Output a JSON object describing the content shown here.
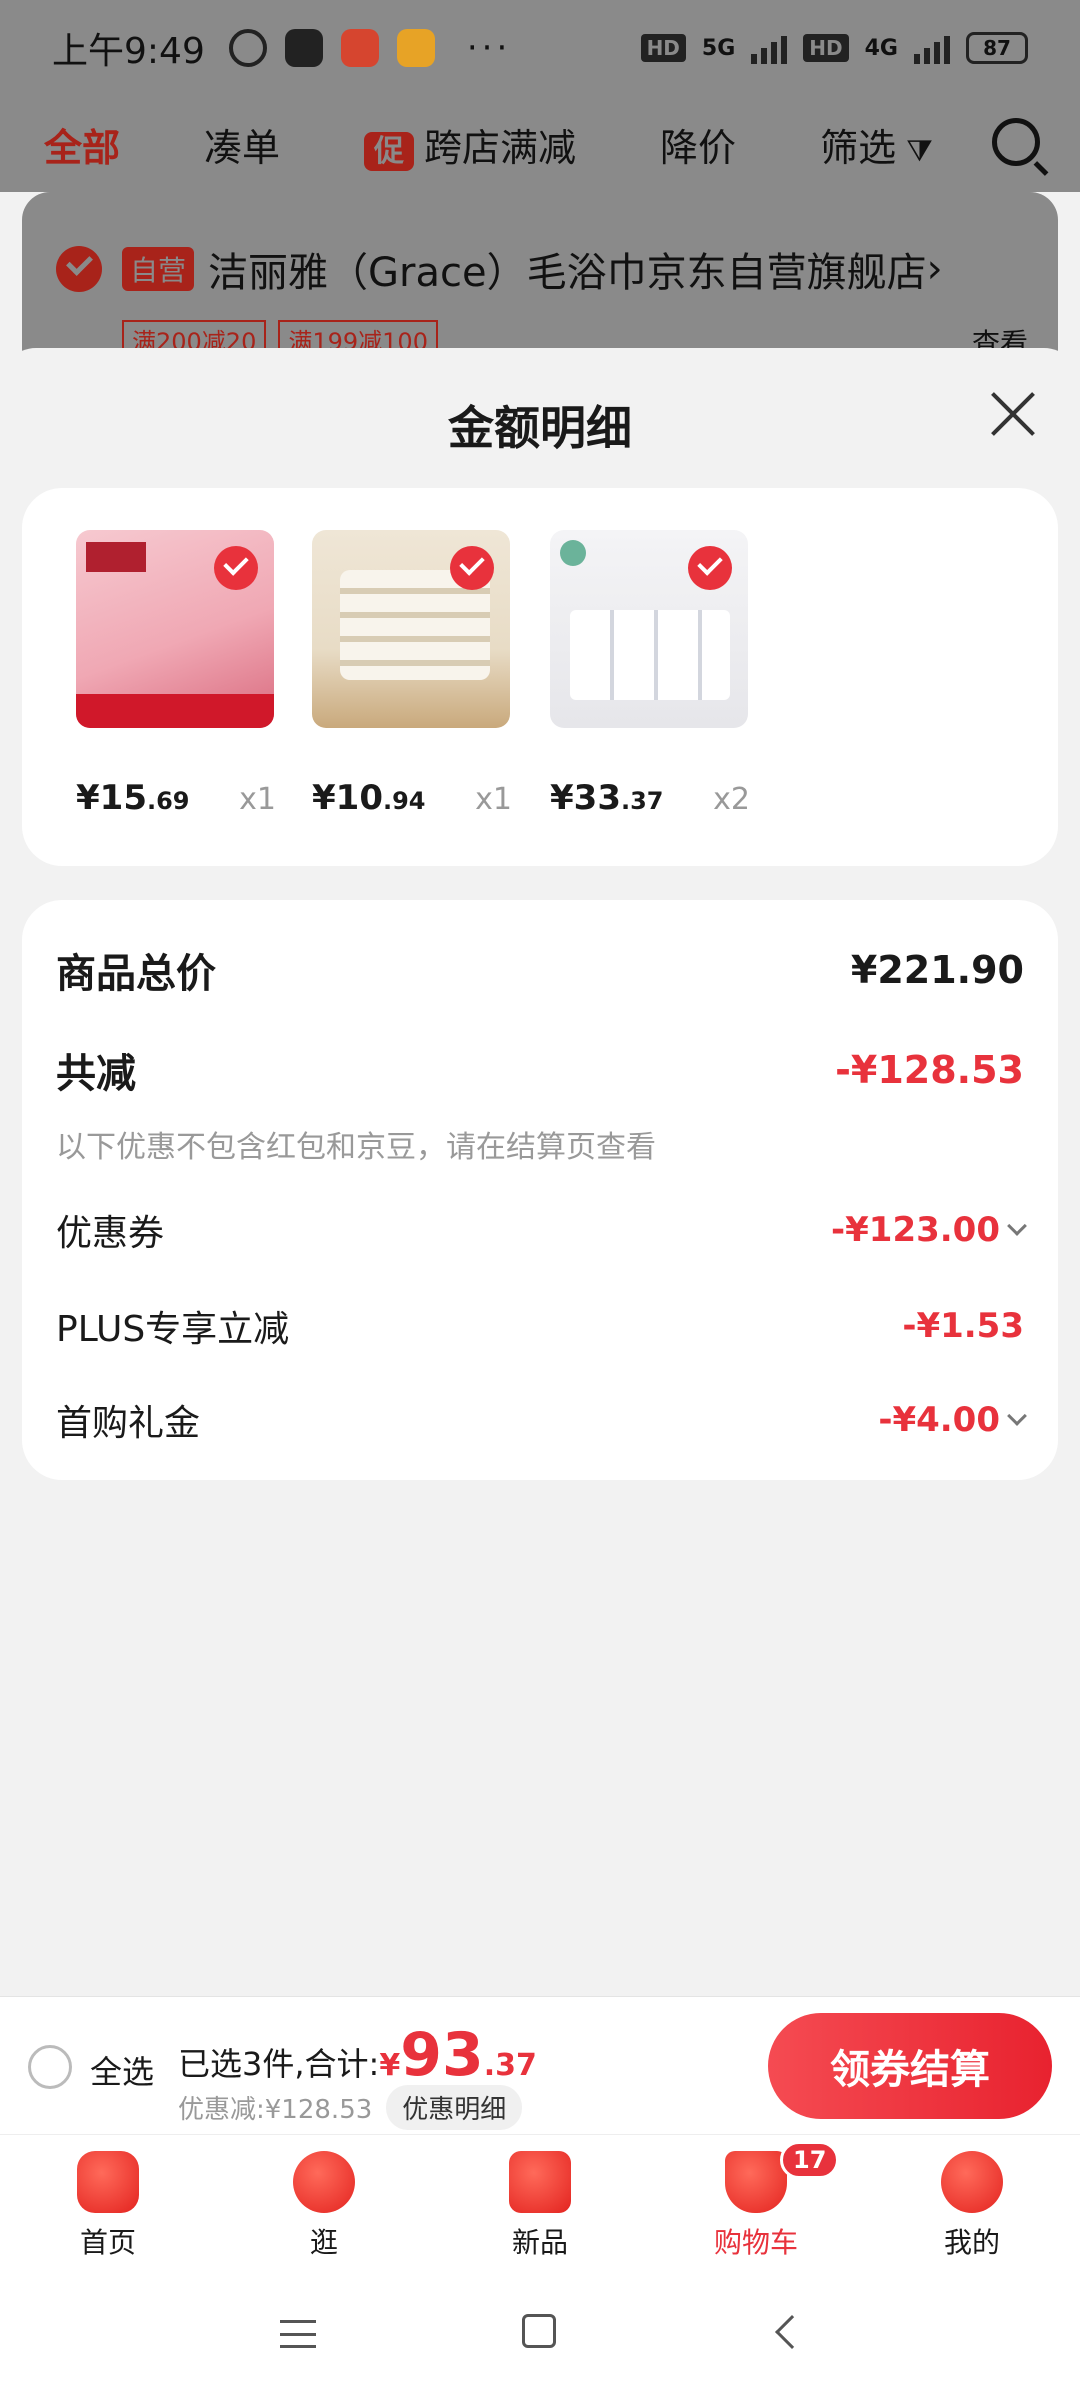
{
  "status_bar": {
    "time": "上午9:49",
    "more": "···",
    "network_5g": "5G",
    "network_4g": "4G",
    "hd1": "HD",
    "hd2": "HD",
    "battery": "87"
  },
  "filter_bar": {
    "tabs": [
      "全部",
      "凑单",
      "跨店满减",
      "降价",
      "筛选"
    ],
    "promo_tag": "促"
  },
  "shop": {
    "self_tag": "自营",
    "name": "洁丽雅（Grace）毛浴巾京东自营旗舰店",
    "deals": [
      "满200减20",
      "满199减100"
    ],
    "view": "查看"
  },
  "sheet": {
    "title": "金额明细"
  },
  "products": [
    {
      "price_int": "¥15",
      "price_dec": ".69",
      "qty": "x1",
      "icon": "yoga-mat-thumb"
    },
    {
      "price_int": "¥10",
      "price_dec": ".94",
      "qty": "x1",
      "icon": "dumpling-tray-thumb"
    },
    {
      "price_int": "¥33",
      "price_dec": ".37",
      "qty": "x2",
      "icon": "tissue-pack-thumb"
    }
  ],
  "summary": {
    "goods_total_label": "商品总价",
    "goods_total_value": "¥221.90",
    "reduce_label": "共减",
    "reduce_value": "-¥128.53",
    "note": "以下优惠不包含红包和京豆，请在结算页查看",
    "coupon_label": "优惠券",
    "coupon_value": "-¥123.00",
    "plus_label": "PLUS专享立减",
    "plus_value": "-¥1.53",
    "gift_label": "首购礼金",
    "gift_value": "-¥4.00"
  },
  "checkout": {
    "select_all": "全选",
    "selected_text": "已选3件,合计:",
    "yen": "¥",
    "total_int": "93",
    "total_dec": ".37",
    "discount_text": "优惠减:¥128.53",
    "detail_chip": "优惠明细",
    "button": "领券结算"
  },
  "bottom_nav": {
    "items": [
      "首页",
      "逛",
      "新品",
      "购物车",
      "我的"
    ],
    "cart_badge": "17"
  },
  "colors": {
    "accent": "#e8323c",
    "overlay": "#8a8a8a"
  }
}
